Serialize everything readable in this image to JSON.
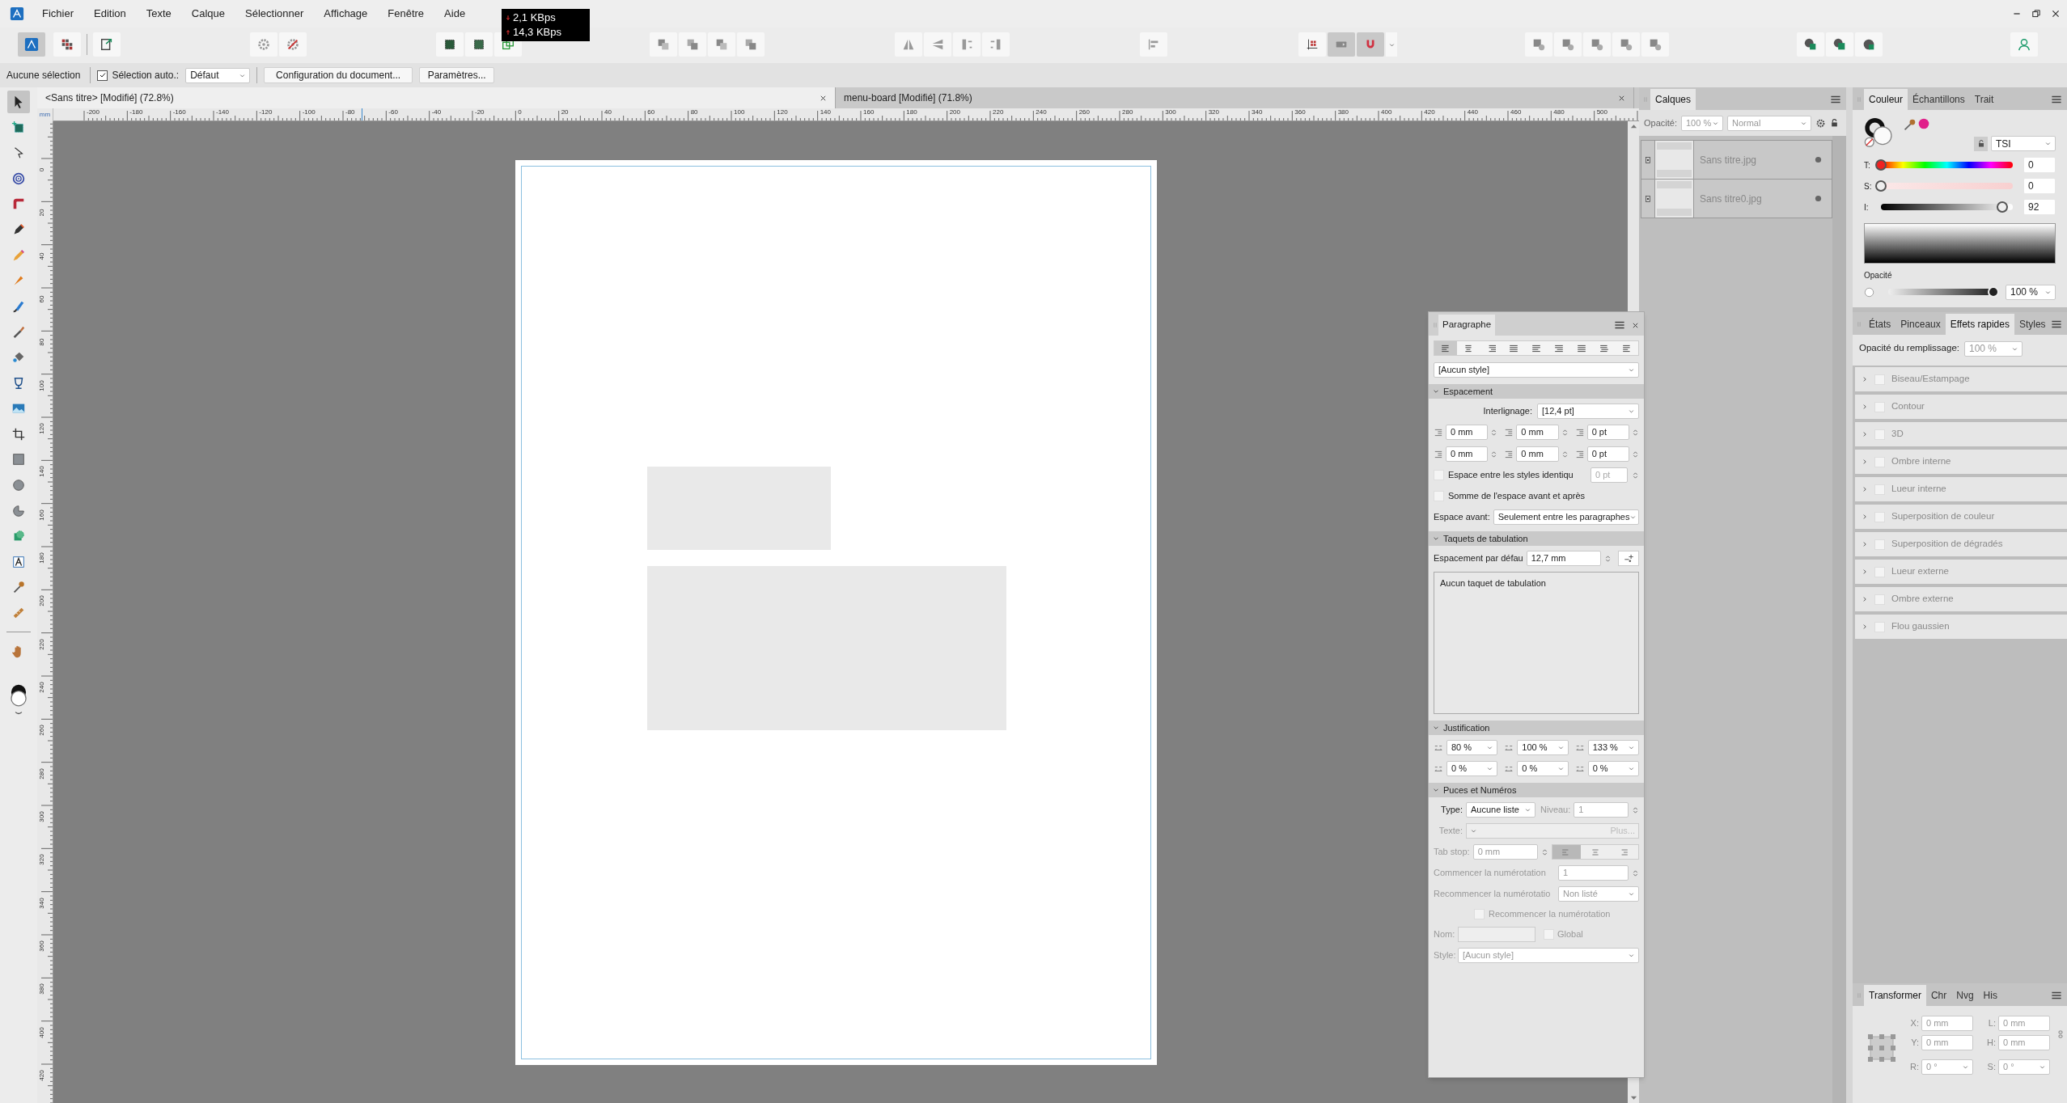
{
  "menu": [
    "Fichier",
    "Edition",
    "Texte",
    "Calque",
    "Sélectionner",
    "Affichage",
    "Fenêtre",
    "Aide"
  ],
  "network_speed": {
    "download": "2,1 KBps",
    "upload": "14,3 KBps"
  },
  "toolbar": {
    "personas": [
      {
        "selected": true
      },
      {
        "selected": false
      },
      {
        "selected": false
      }
    ],
    "snapping": [
      {
        "selected": false
      },
      {
        "selected": true
      },
      {
        "selected": true
      }
    ]
  },
  "context_bar": {
    "status": "Aucune sélection",
    "auto_select": {
      "label": "Sélection auto.:",
      "checked": true
    },
    "mode": "Défaut",
    "buttons": [
      "Configuration du document...",
      "Paramètres..."
    ]
  },
  "document_tabs": [
    {
      "title": "<Sans titre> [Modifié] (72.8%)",
      "selected": true
    },
    {
      "title": "menu-board [Modifié] (71.8%)",
      "selected": false
    }
  ],
  "tools": [
    {
      "selected": true
    },
    {
      "selected": false
    },
    {
      "selected": false
    },
    {
      "selected": false
    },
    {
      "selected": false
    },
    {
      "selected": false
    },
    {
      "selected": false
    },
    {
      "selected": false
    },
    {
      "selected": false
    },
    {
      "selected": false
    },
    {
      "selected": false
    },
    {
      "selected": false
    },
    {
      "selected": false
    },
    {
      "selected": false
    },
    {
      "selected": false
    },
    {
      "selected": false
    },
    {
      "selected": false
    },
    {
      "selected": false
    },
    {
      "selected": false
    },
    {
      "selected": false
    },
    {
      "selected": false
    },
    {
      "selected": false
    }
  ],
  "rulers": {
    "unit": "mm",
    "horizontal": [
      "-200",
      "-180",
      "-160",
      "-140",
      "-120",
      "-100",
      "-80",
      "-60",
      "-40",
      "-20",
      "0",
      "20",
      "40",
      "60",
      "80",
      "100",
      "120",
      "140",
      "160",
      "180",
      "200",
      "220",
      "240",
      "260",
      "280",
      "300",
      "320",
      "340",
      "360",
      "380",
      "400",
      "420",
      "440",
      "460",
      "480",
      "500"
    ],
    "vertical": [
      "0",
      "20",
      "40",
      "60",
      "80",
      "100",
      "120",
      "140",
      "160",
      "180",
      "200",
      "220",
      "240",
      "260",
      "280",
      "300",
      "320",
      "340",
      "360",
      "380",
      "400",
      "420"
    ]
  },
  "layers_panel": {
    "tabs": [
      {
        "label": "Calques",
        "selected": true
      }
    ],
    "opacity_label": "Opacité:",
    "opacity": "100 %",
    "blend_mode": "Normal",
    "layers": [
      {
        "name": "Sans titre.jpg"
      },
      {
        "name": "Sans titre0.jpg"
      }
    ]
  },
  "color_panel": {
    "tabs": [
      {
        "label": "Couleur",
        "selected": true
      },
      {
        "label": "Échantillons",
        "selected": false
      },
      {
        "label": "Trait",
        "selected": false
      }
    ],
    "model": "TSI",
    "sliders": [
      {
        "kind": "hue",
        "label": "T:",
        "level": 0,
        "reading": "0"
      },
      {
        "kind": "saturation",
        "label": "S:",
        "level": 0,
        "reading": "0"
      },
      {
        "kind": "intensity",
        "label": "I:",
        "level": 0.92,
        "reading": "92"
      }
    ],
    "opacity_label": "Opacité",
    "opacity": {
      "level": 1,
      "reading": "100 %"
    }
  },
  "effects_panel": {
    "tabs": [
      {
        "label": "États",
        "selected": false
      },
      {
        "label": "Pinceaux",
        "selected": false
      },
      {
        "label": "Effets rapides",
        "selected": true
      },
      {
        "label": "Styles",
        "selected": false
      }
    ],
    "fill_opacity_label": "Opacité du remplissage:",
    "fill_opacity": "100 %",
    "effects": [
      {
        "label": "Biseau/Estampage",
        "checked": false,
        "disabled": true
      },
      {
        "label": "Contour",
        "checked": false,
        "disabled": true
      },
      {
        "label": "3D",
        "checked": false,
        "disabled": true
      },
      {
        "label": "Ombre interne",
        "checked": false,
        "disabled": true
      },
      {
        "label": "Lueur interne",
        "checked": false,
        "disabled": true
      },
      {
        "label": "Superposition de couleur",
        "checked": false,
        "disabled": true
      },
      {
        "label": "Superposition de dégradés",
        "checked": false,
        "disabled": true
      },
      {
        "label": "Lueur externe",
        "checked": false,
        "disabled": true
      },
      {
        "label": "Ombre externe",
        "checked": false,
        "disabled": true
      },
      {
        "label": "Flou gaussien",
        "checked": false,
        "disabled": true
      }
    ]
  },
  "transform_panel": {
    "tabs": [
      {
        "label": "Transformer",
        "selected": true
      },
      {
        "label": "Chr",
        "selected": false
      },
      {
        "label": "Nvg",
        "selected": false
      },
      {
        "label": "His",
        "selected": false
      }
    ],
    "fields": [
      {
        "label": "X:",
        "value": "0 mm"
      },
      {
        "label": "L:",
        "value": "0 mm"
      },
      {
        "label": "Y:",
        "value": "0 mm"
      },
      {
        "label": "H:",
        "value": "0 mm"
      },
      {
        "label": "R:",
        "value": "0 °"
      },
      {
        "label": "S:",
        "value": "0 °"
      }
    ]
  },
  "paragraph_panel": {
    "title": "Paragraphe",
    "alignments": [
      {
        "selected": true
      },
      {
        "selected": false
      },
      {
        "selected": false
      },
      {
        "selected": false
      },
      {
        "selected": false
      },
      {
        "selected": false
      },
      {
        "selected": false
      },
      {
        "selected": false
      },
      {
        "selected": false
      }
    ],
    "style": "[Aucun style]",
    "spacing": {
      "title": "Espacement",
      "expanded": true,
      "leading_label": "Interlignage:",
      "leading": "[12,4 pt]",
      "fields": [
        "0 mm",
        "0 mm",
        "0 pt",
        "0 mm",
        "0 mm",
        "0 pt"
      ],
      "options": [
        {
          "label": "Espace entre les styles identiqu",
          "checked": false,
          "value": "0 pt"
        },
        {
          "label": "Somme de l'espace avant et après",
          "checked": false
        }
      ],
      "space_before_label": "Espace avant:",
      "space_before": "Seulement entre les paragraphes"
    },
    "tab_stops": {
      "title": "Taquets de tabulation",
      "expanded": true,
      "default_label": "Espacement par défau",
      "default": "12,7 mm",
      "empty_text": "Aucun taquet de tabulation"
    },
    "justification": {
      "title": "Justification",
      "expanded": true,
      "fields": [
        "80 %",
        "100 %",
        "133 %",
        "0 %",
        "0 %",
        "0 %"
      ]
    },
    "bullets": {
      "title": "Puces et Numéros",
      "expanded": true,
      "type_label": "Type:",
      "type": "Aucune liste",
      "level_label": "Niveau:",
      "level_value": "1",
      "text_label": "Texte:",
      "more": "Plus...",
      "tab_stop_label": "Tab stop:",
      "tab_stop": "0 mm",
      "tab_alignments": [
        {
          "selected": true
        },
        {
          "selected": false
        },
        {
          "selected": false
        }
      ],
      "start_label": "Commencer la numérotation",
      "start": "1",
      "restart_label": "Recommencer la numérotatio",
      "restart": "Non listé",
      "restart_option": {
        "label": "Recommencer la numérotation",
        "checked": false
      },
      "name_label": "Nom:",
      "global": {
        "label": "Global",
        "checked": false
      },
      "style_label": "Style:",
      "style": "[Aucun style]"
    }
  }
}
